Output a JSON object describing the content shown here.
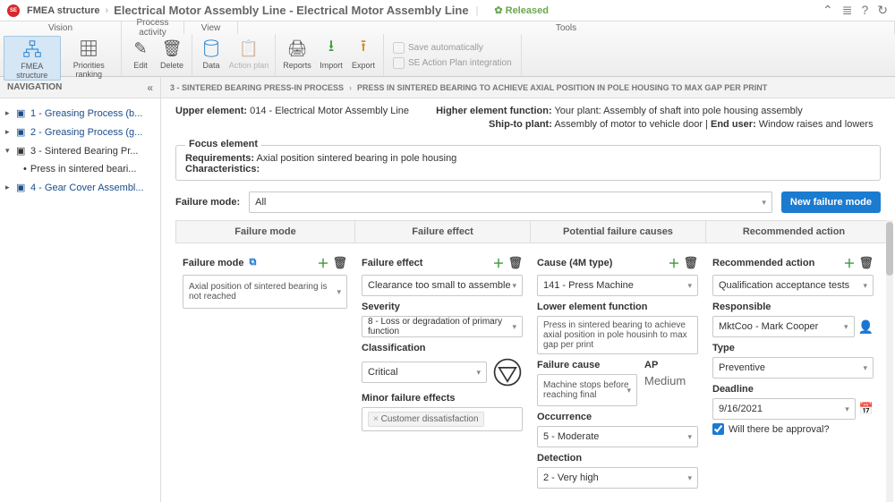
{
  "header": {
    "breadcrumb_root": "FMEA structure",
    "title": "Electrical Motor Assembly Line - Electrical Motor Assembly Line",
    "status": "Released"
  },
  "ribbon": {
    "tabs": {
      "vision": "Vision",
      "process": "Process activity",
      "view": "View",
      "tools": "Tools"
    },
    "buttons": {
      "fmea": "FMEA structure",
      "priorities": "Priorities ranking",
      "edit": "Edit",
      "delete": "Delete",
      "data": "Data",
      "action_plan": "Action plan",
      "reports": "Reports",
      "import": "Import",
      "export": "Export"
    },
    "checks": {
      "save_auto": "Save automatically",
      "se_action": "SE Action Plan integration"
    }
  },
  "nav": {
    "title": "NAVIGATION",
    "items": [
      "1 - Greasing Process (b...",
      "2 - Greasing Process (g...",
      "3 - Sintered Bearing Pr...",
      "Press in sintered beari...",
      "4 - Gear Cover Assembl..."
    ]
  },
  "crumb2": {
    "a": "3 - SINTERED BEARING PRESS-IN PROCESS",
    "b": "PRESS IN SINTERED BEARING TO ACHIEVE AXIAL POSITION IN POLE HOUSING TO MAX GAP PER PRINT"
  },
  "info": {
    "upper_lbl": "Upper element:",
    "upper_val": "014 - Electrical Motor Assembly Line",
    "higher_lbl": "Higher element function:",
    "higher_your": "Your plant:",
    "higher_your_val": "Assembly of shaft into pole housing assembly",
    "ship_lbl": "Ship-to plant:",
    "ship_val": "Assembly of motor to vehicle door",
    "end_lbl": "End user:",
    "end_val": "Window raises and lowers"
  },
  "focus": {
    "legend": "Focus element",
    "req_lbl": "Requirements:",
    "req_val": "Axial position sintered bearing in pole housing",
    "char_lbl": "Characteristics:"
  },
  "filter": {
    "label": "Failure mode:",
    "value": "All",
    "new_btn": "New failure mode"
  },
  "cols": {
    "c1": "Failure mode",
    "c2": "Failure effect",
    "c3": "Potential failure causes",
    "c4": "Recommended action"
  },
  "fm": {
    "mode_lbl": "Failure mode",
    "mode_val": "Axial position of sintered bearing is not reached",
    "effect_lbl": "Failure effect",
    "effect_val": "Clearance too small to assemble",
    "severity_lbl": "Severity",
    "severity_val": "8 - Loss or degradation of primary function",
    "class_lbl": "Classification",
    "class_val": "Critical",
    "minor_lbl": "Minor failure effects",
    "minor_tag": "Customer dissatisfaction",
    "cause_lbl": "Cause (4M type)",
    "cause_val": "141 - Press Machine",
    "lower_lbl": "Lower element function",
    "lower_val": "Press in sintered bearing to achieve axial position in pole housinh to max gap per print",
    "fcause_lbl": "Failure cause",
    "fcause_val": "Machine stops before reaching final",
    "ap_lbl": "AP",
    "ap_val": "Medium",
    "occ_lbl": "Occurrence",
    "occ_val": "5 - Moderate",
    "det_lbl": "Detection",
    "det_val": "2 - Very high",
    "rec_lbl": "Recommended action",
    "rec_val": "Qualification acceptance tests",
    "resp_lbl": "Responsible",
    "resp_val": "MktCoo - Mark Cooper",
    "type_lbl": "Type",
    "type_val": "Preventive",
    "deadline_lbl": "Deadline",
    "deadline_val": "9/16/2021",
    "approval_lbl": "Will there be approval?"
  }
}
